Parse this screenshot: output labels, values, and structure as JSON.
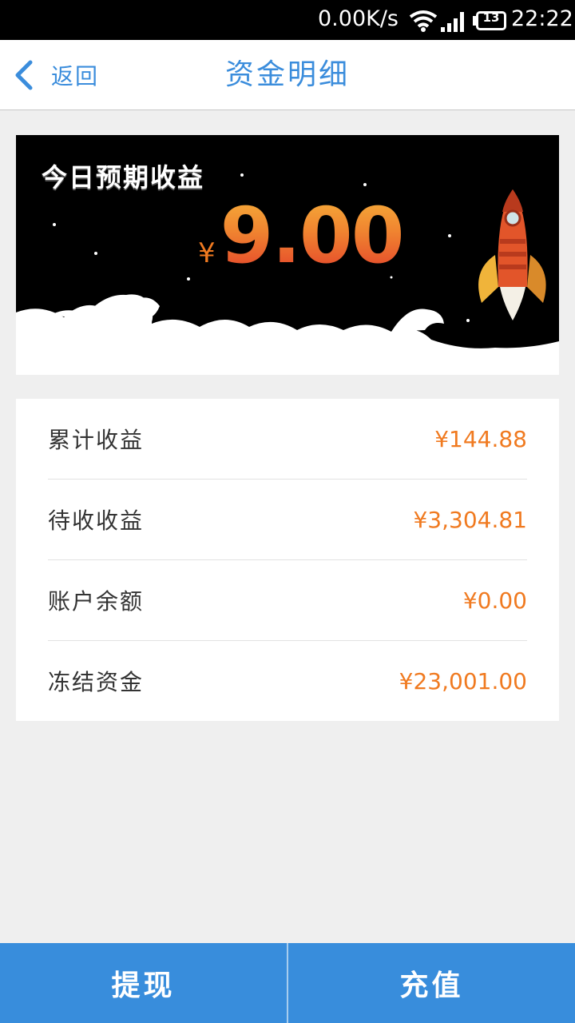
{
  "status_bar": {
    "net_speed": "0.00K/s",
    "battery_level": "13",
    "time": "22:22"
  },
  "nav": {
    "back_label": "返回",
    "title": "资金明细"
  },
  "banner": {
    "headline": "今日预期收益",
    "currency": "¥",
    "amount": "9.00"
  },
  "summary": {
    "rows": [
      {
        "label": "累计收益",
        "value": "¥144.88"
      },
      {
        "label": "待收收益",
        "value": "¥3,304.81"
      },
      {
        "label": "账户余额",
        "value": "¥0.00"
      },
      {
        "label": "冻结资金",
        "value": "¥23,001.00"
      }
    ]
  },
  "actions": {
    "withdraw_label": "提现",
    "recharge_label": "充值"
  },
  "colors": {
    "accent": "#3b8ddc",
    "value": "#f07a20",
    "button": "#388ddc"
  }
}
